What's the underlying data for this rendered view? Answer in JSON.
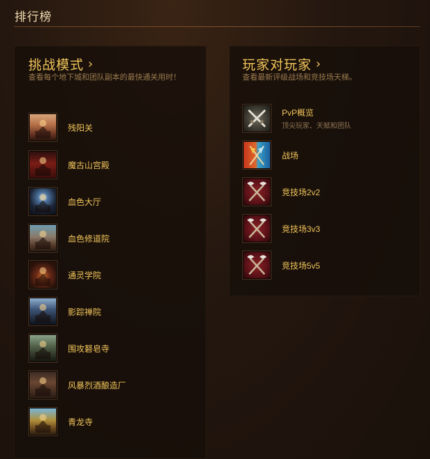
{
  "header": {
    "title": "排行榜"
  },
  "challenge": {
    "heading": "挑战模式",
    "description": "查看每个地下城和团队副本的最快通关用时！",
    "dungeons": [
      {
        "label": "残阳关"
      },
      {
        "label": "魔古山宫殿"
      },
      {
        "label": "血色大厅"
      },
      {
        "label": "血色修道院"
      },
      {
        "label": "通灵学院"
      },
      {
        "label": "影踪禅院"
      },
      {
        "label": "围攻砮皂寺"
      },
      {
        "label": "风暴烈酒酿造厂"
      },
      {
        "label": "青龙寺"
      }
    ]
  },
  "pvp": {
    "heading": "玩家对玩家",
    "description": "查看最新评级战场和竞技场天梯。",
    "items": [
      {
        "label": "PvP概览",
        "sub": "顶尖玩家、天赋和团队",
        "icon": "crossed-swords-icon"
      },
      {
        "label": "战场",
        "sub": "",
        "icon": "faction-banners-icon"
      },
      {
        "label": "竞技场2v2",
        "sub": "",
        "icon": "crossed-axes-icon"
      },
      {
        "label": "竞技场3v3",
        "sub": "",
        "icon": "crossed-axes-icon"
      },
      {
        "label": "竞技场5v5",
        "sub": "",
        "icon": "crossed-axes-icon"
      }
    ]
  },
  "colors": {
    "accent": "#f1c55a",
    "muted": "#9a7a4e",
    "background": "#24170f",
    "panel": "#160e09"
  }
}
